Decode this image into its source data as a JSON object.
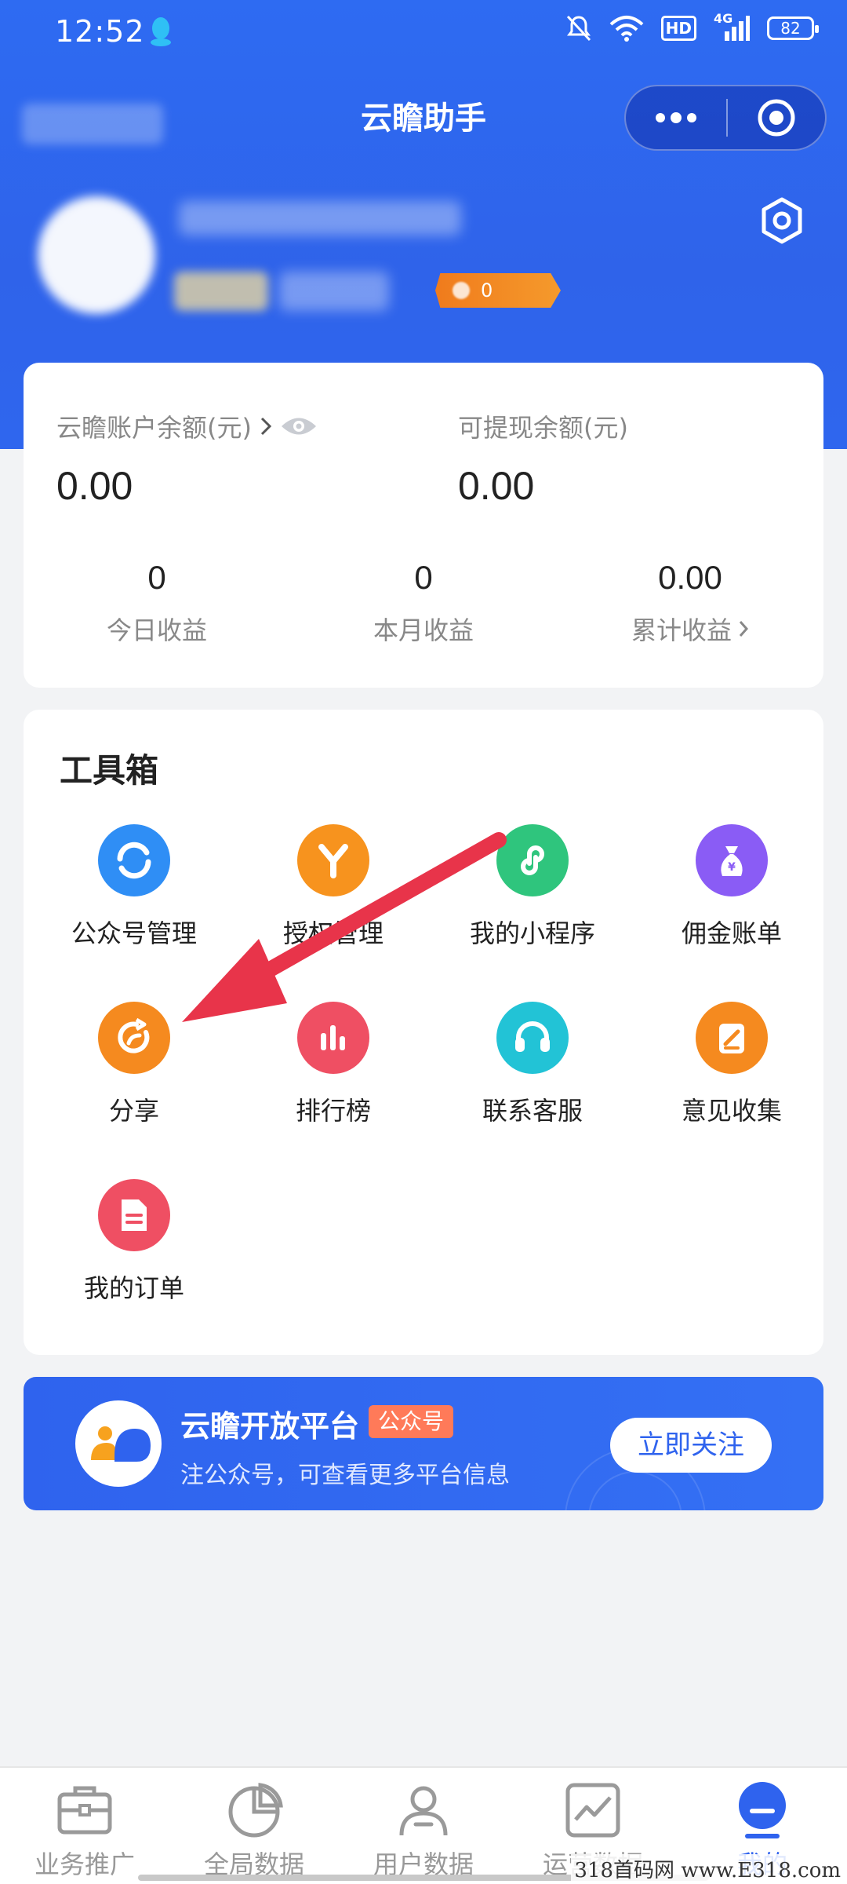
{
  "status_bar": {
    "time": "12:52",
    "network_label": "4G",
    "hd_label": "HD",
    "battery": "82"
  },
  "header": {
    "title": "云瞻助手",
    "level_value": "0"
  },
  "balance": {
    "account_label": "云瞻账户余额(元)",
    "account_value": "0.00",
    "withdrawable_label": "可提现余额(元)",
    "withdrawable_value": "0.00",
    "stats": [
      {
        "value": "0",
        "label": "今日收益"
      },
      {
        "value": "0",
        "label": "本月收益"
      },
      {
        "value": "0.00",
        "label": "累计收益"
      }
    ]
  },
  "toolbox": {
    "title": "工具箱",
    "items": [
      {
        "label": "公众号管理",
        "icon": "wechat-official-icon",
        "color": "#2f8ef5"
      },
      {
        "label": "授权管理",
        "icon": "authorization-icon",
        "color": "#f7931e"
      },
      {
        "label": "我的小程序",
        "icon": "mini-program-icon",
        "color": "#2fc57d"
      },
      {
        "label": "佣金账单",
        "icon": "money-bag-icon",
        "color": "#8a5cf5"
      },
      {
        "label": "分享",
        "icon": "share-icon",
        "color": "#f58a1f"
      },
      {
        "label": "排行榜",
        "icon": "ranking-icon",
        "color": "#ef4f63"
      },
      {
        "label": "联系客服",
        "icon": "headset-icon",
        "color": "#22c3d6"
      },
      {
        "label": "意见收集",
        "icon": "feedback-icon",
        "color": "#f58a1f"
      },
      {
        "label": "我的订单",
        "icon": "order-icon",
        "color": "#ef4f63"
      }
    ]
  },
  "banner": {
    "title": "云瞻开放平台",
    "tag": "公众号",
    "description": "注公众号，可查看更多平台信息",
    "button": "立即关注"
  },
  "bottom_nav": {
    "items": [
      {
        "label": "业务推广",
        "icon": "briefcase-icon",
        "active": false
      },
      {
        "label": "全局数据",
        "icon": "pie-chart-icon",
        "active": false
      },
      {
        "label": "用户数据",
        "icon": "user-icon",
        "active": false
      },
      {
        "label": "运营数据",
        "icon": "line-chart-icon",
        "active": false
      },
      {
        "label": "我的",
        "icon": "profile-icon",
        "active": true
      }
    ]
  },
  "watermark": "318首码网 www.E318.com",
  "colors": {
    "primary": "#2f63ee",
    "background": "#f2f3f5",
    "annotation_arrow": "#e8344a"
  }
}
